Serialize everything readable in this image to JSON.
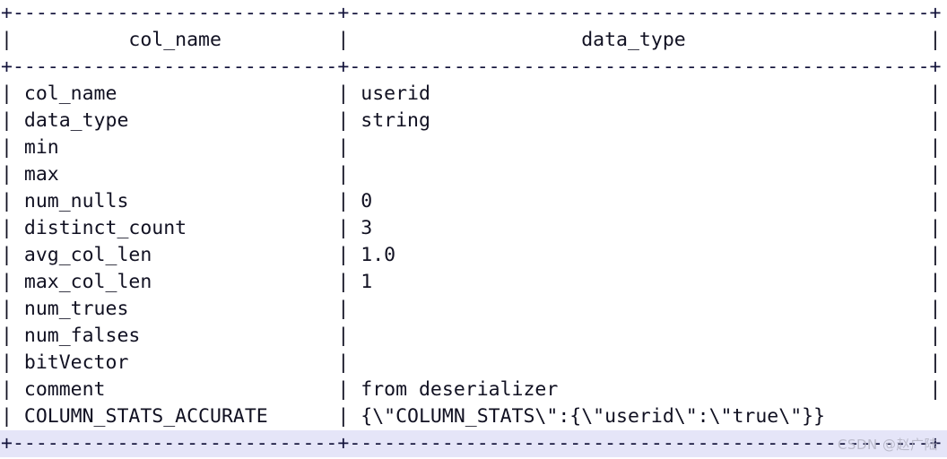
{
  "terminal": {
    "columns": {
      "col1_header": "col_name",
      "col2_header": "data_type",
      "col1_width": 28,
      "col2_width": 50
    },
    "rule_top": "+----------------------------+--------------------------------------------------+",
    "rule_header": "+----------------------------+--------------------------------------------------+",
    "rule_bottom": "+----------------------------+--------------------------------------------------+",
    "header_line": "|          col_name          |                    data_type                     |",
    "rows": [
      {
        "col_name": "col_name",
        "data_type": "userid"
      },
      {
        "col_name": "data_type",
        "data_type": "string"
      },
      {
        "col_name": "min",
        "data_type": ""
      },
      {
        "col_name": "max",
        "data_type": ""
      },
      {
        "col_name": "num_nulls",
        "data_type": "0"
      },
      {
        "col_name": "distinct_count",
        "data_type": "3"
      },
      {
        "col_name": "avg_col_len",
        "data_type": "1.0"
      },
      {
        "col_name": "max_col_len",
        "data_type": "1"
      },
      {
        "col_name": "num_trues",
        "data_type": ""
      },
      {
        "col_name": "num_falses",
        "data_type": ""
      },
      {
        "col_name": "bitVector",
        "data_type": ""
      },
      {
        "col_name": "comment",
        "data_type": "from deserializer"
      },
      {
        "col_name": "COLUMN_STATS_ACCURATE",
        "data_type": "{\\\"COLUMN_STATS\\\":{\\\"userid\\\":\\\"true\\\"}}"
      }
    ],
    "row_lines": [
      "| col_name                   | userid                                           |",
      "| data_type                  | string                                           |",
      "| min                        |                                                  |",
      "| max                        |                                                  |",
      "| num_nulls                  | 0                                                |",
      "| distinct_count             | 3                                                |",
      "| avg_col_len                | 1.0                                              |",
      "| max_col_len                | 1                                                |",
      "| num_trues                  |                                                  |",
      "| num_falses                 |                                                  |",
      "| bitVector                  |                                                  |",
      "| comment                    | from deserializer                                |",
      "| COLUMN_STATS_ACCURATE      | {\\\"COLUMN_STATS\\\":{\\\"userid\\\":\\\"true\\\"}}              |"
    ],
    "watermark": "CSDN @赵广陆",
    "colors": {
      "background": "#ffffff",
      "text": "#111122",
      "selection": "#e5e5f8",
      "watermark": "#b9b9c9"
    }
  }
}
